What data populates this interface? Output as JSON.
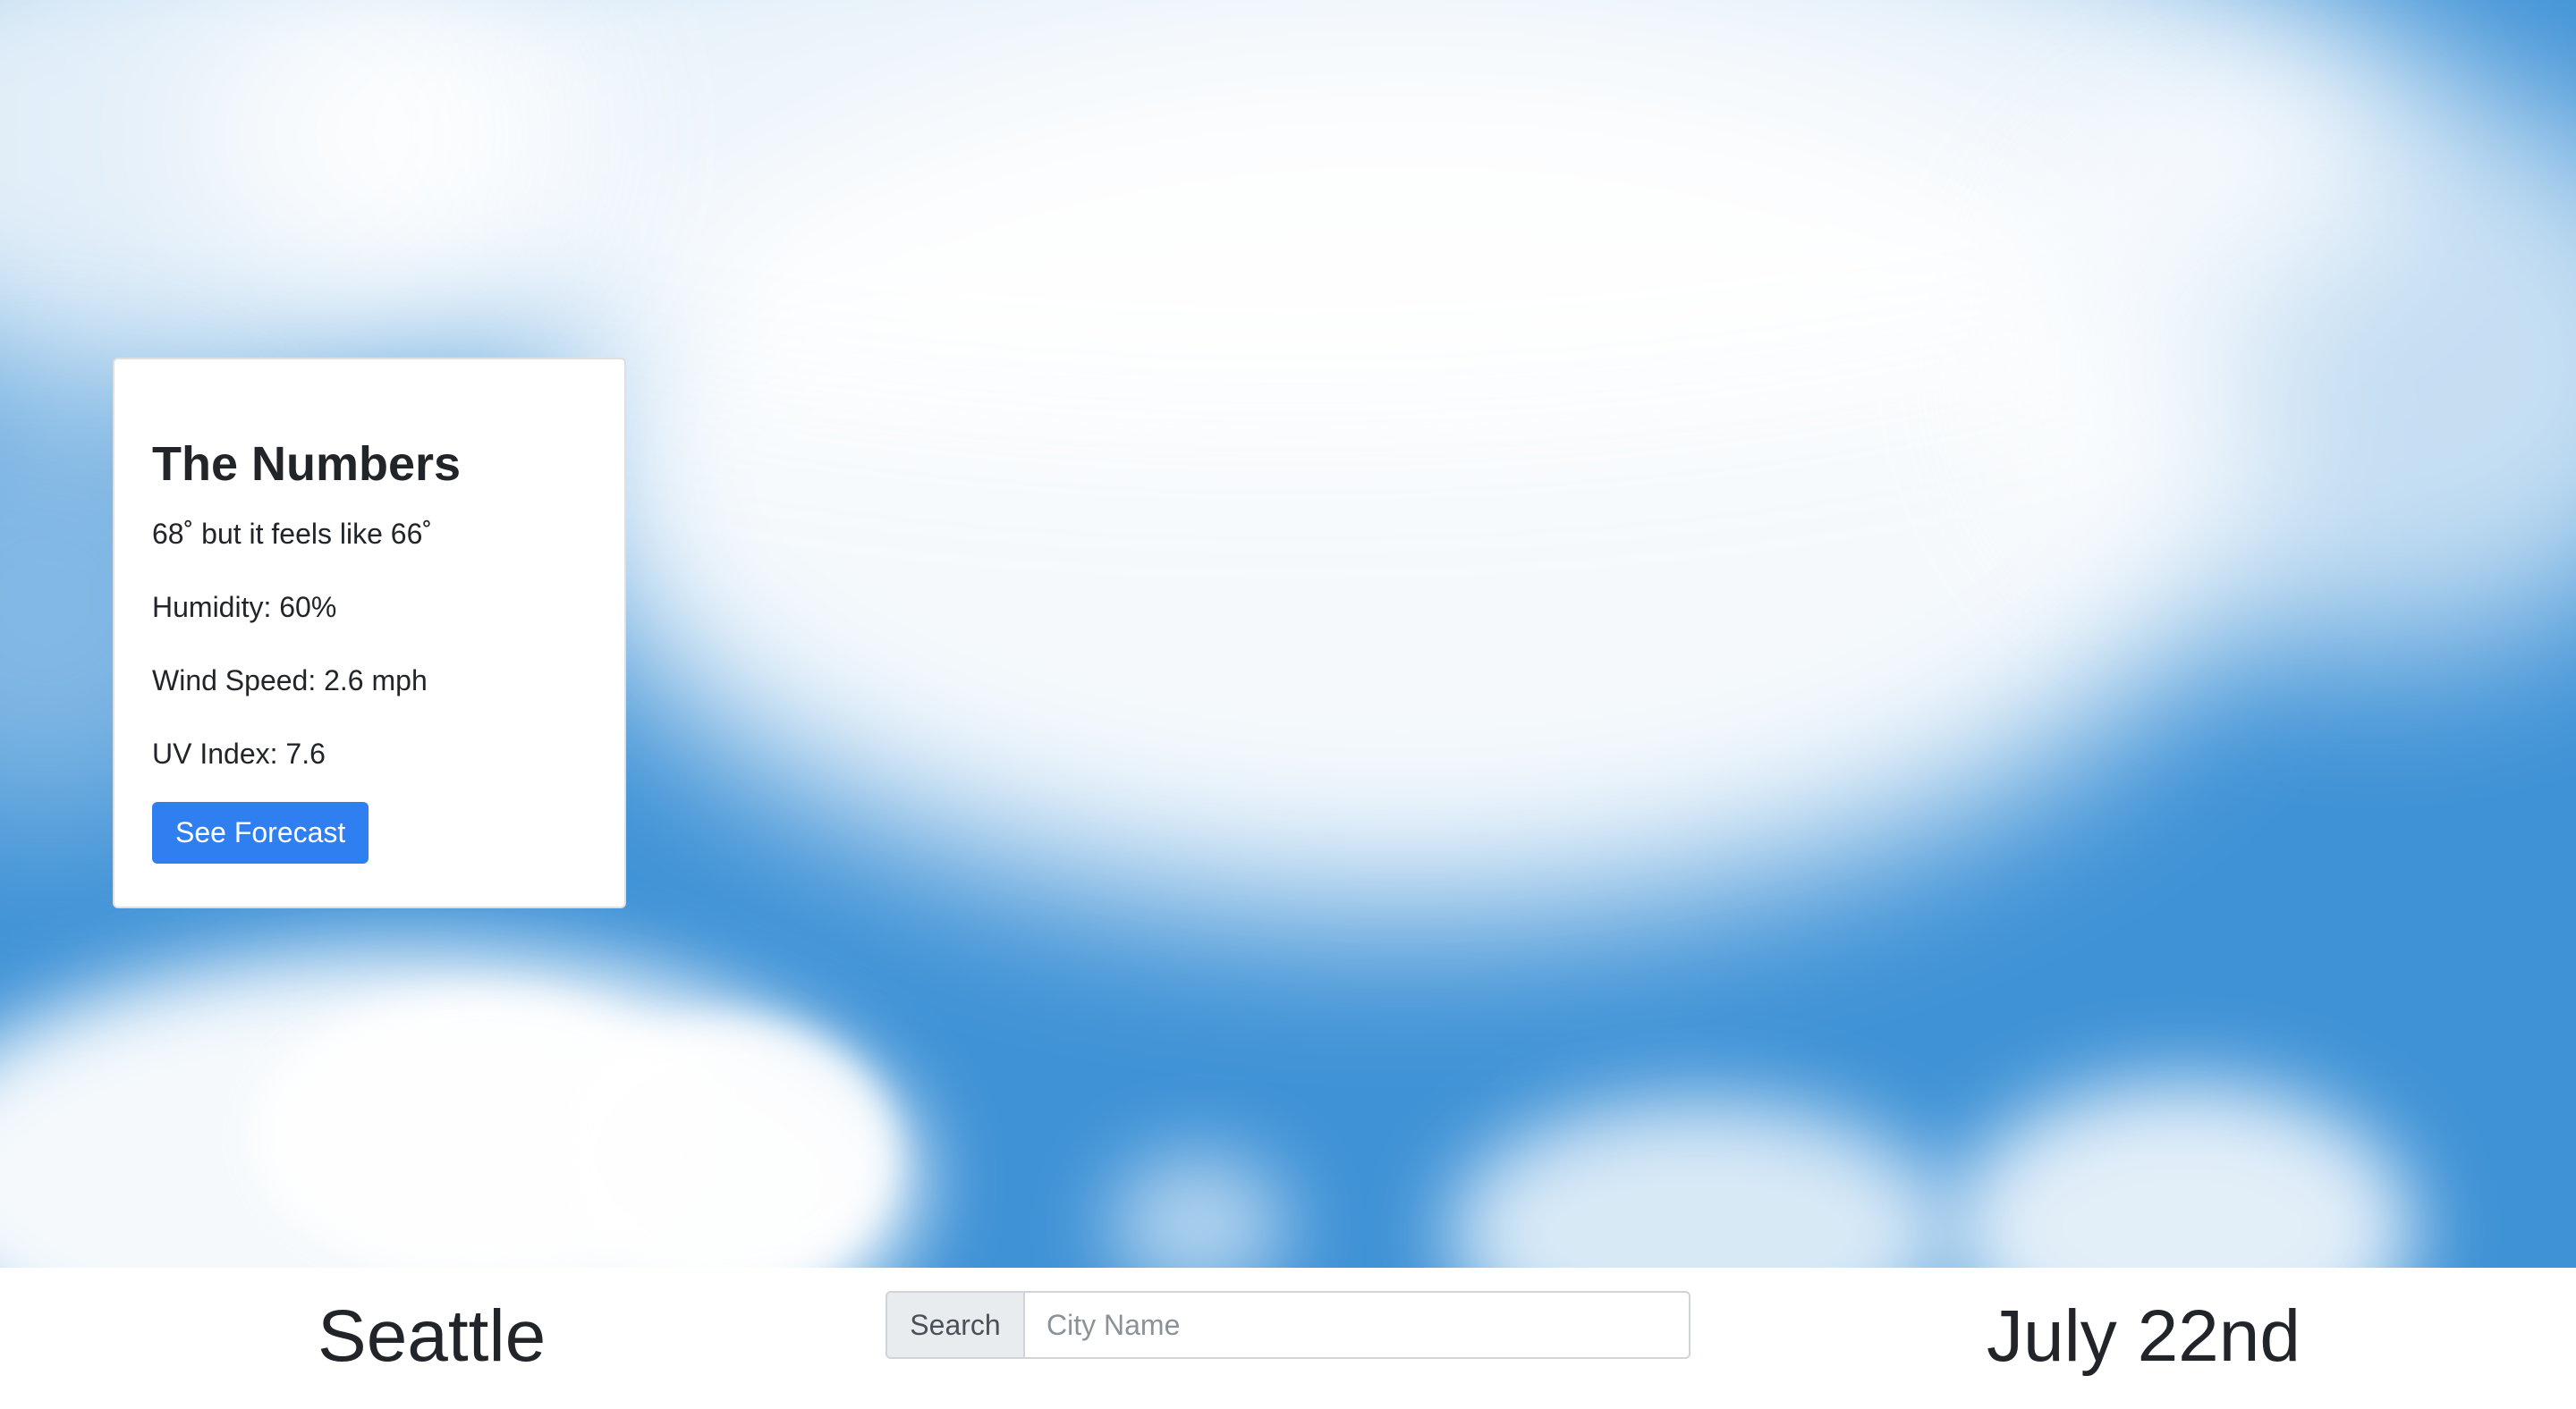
{
  "card": {
    "title": "The Numbers",
    "temperature_line": "68˚ but it feels like 66˚",
    "humidity_line": "Humidity: 60%",
    "wind_line": "Wind Speed: 2.6 mph",
    "uv_line": "UV Index: 7.6",
    "forecast_button_label": "See Forecast"
  },
  "bottom_bar": {
    "city": "Seattle",
    "date": "July 22nd",
    "search": {
      "label": "Search",
      "placeholder": "City Name",
      "value": ""
    }
  },
  "colors": {
    "sky": "#3f92d6",
    "button": "#2f7ff1",
    "text": "#212529"
  }
}
